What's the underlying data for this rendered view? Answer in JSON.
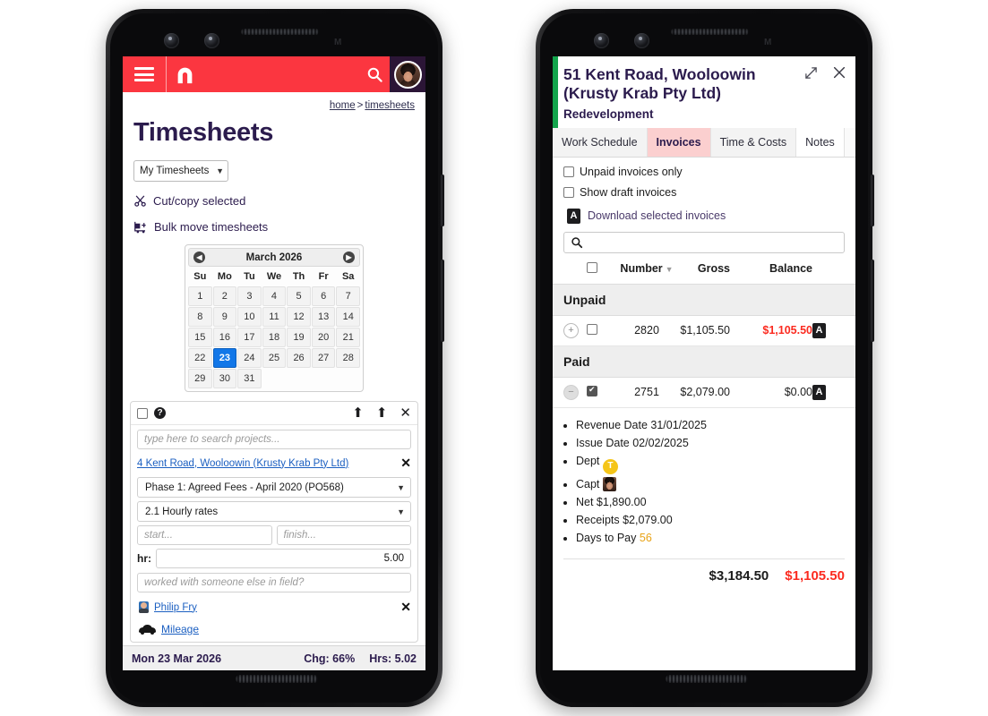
{
  "left_phone": {
    "app": {
      "topbar": {
        "menu_icon": "hamburger-menu-icon",
        "logo_icon": "arch-brand-logo",
        "search_icon": "search-icon",
        "avatar_icon": "user-avatar"
      },
      "breadcrumb": {
        "home": "home",
        "separator": ">",
        "current": "timesheets"
      },
      "page_title": "Timesheets",
      "filter_select": {
        "value": "My Timesheets",
        "chevron": "chevron-down-icon"
      },
      "actions": [
        {
          "icon": "scissors-icon",
          "label": "Cut/copy selected"
        },
        {
          "icon": "dolly-truck-icon",
          "label": "Bulk move timesheets"
        }
      ],
      "calendar": {
        "prev_icon": "prev-month-icon",
        "next_icon": "next-month-icon",
        "title": "March 2026",
        "dow": [
          "Su",
          "Mo",
          "Tu",
          "We",
          "Th",
          "Fr",
          "Sa"
        ],
        "lead_blanks": 0,
        "days": [
          1,
          2,
          3,
          4,
          5,
          6,
          7,
          8,
          9,
          10,
          11,
          12,
          13,
          14,
          15,
          16,
          17,
          18,
          19,
          20,
          21,
          22,
          23,
          24,
          25,
          26,
          27,
          28,
          29,
          30,
          31
        ],
        "selected": 23
      },
      "entry": {
        "header": {
          "checkbox": false,
          "help_icon": "help-icon",
          "icons": [
            "arrow-up-icon",
            "arrow-up-icon",
            "close-icon"
          ]
        },
        "project_search_placeholder": "type here to search projects...",
        "project_link": "4 Kent Road, Wooloowin (Krusty Krab Pty Ltd)",
        "project_remove_icon": "remove-project-icon",
        "phase_select": "Phase 1: Agreed Fees - April 2020 (PO568)",
        "rate_select": "2.1 Hourly rates",
        "start_placeholder": "start...",
        "finish_placeholder": "finish...",
        "hours_label": "hr:",
        "hours_value": "5.00",
        "note_placeholder": "worked with someone else in field?",
        "person": "Philip Fry",
        "person_remove_icon": "remove-person-icon",
        "mileage": "Mileage"
      },
      "status_bar": {
        "date": "Mon 23 Mar 2026",
        "chg": "Chg: 66%",
        "hrs": "Hrs: 5.02"
      }
    }
  },
  "right_phone": {
    "app": {
      "accent_color": "#13a44c",
      "header": {
        "title": "51 Kent Road, Wooloowin (Krusty Krab Pty Ltd)",
        "subtitle": "Redevelopment",
        "expand_icon": "expand-icon",
        "close_icon": "close-icon"
      },
      "tabs": [
        {
          "label": "Work Schedule",
          "active": false
        },
        {
          "label": "Invoices",
          "active": true
        },
        {
          "label": "Time & Costs",
          "active": false
        },
        {
          "label": "Notes",
          "active": false
        }
      ],
      "filters": [
        {
          "label": "Unpaid invoices only",
          "checked": false
        },
        {
          "label": "Show draft invoices",
          "checked": false
        }
      ],
      "download_action": {
        "icon": "pdf-icon",
        "label": "Download selected invoices"
      },
      "search_placeholder": "",
      "search_icon": "search-icon",
      "table": {
        "headers": {
          "select_all": "select-all-checkbox",
          "number": "Number",
          "sort_icon": "sort-descending-icon",
          "gross": "Gross",
          "balance": "Balance"
        },
        "groups": [
          {
            "name": "Unpaid",
            "rows": [
              {
                "expand": "plus",
                "checked": false,
                "number": "2820",
                "gross": "$1,105.50",
                "balance": "$1,105.50",
                "balance_color": "#fb2b20",
                "pdf_icon": "pdf-icon"
              }
            ]
          },
          {
            "name": "Paid",
            "rows": [
              {
                "expand": "minus",
                "checked": true,
                "number": "2751",
                "gross": "$2,079.00",
                "balance": "$0.00",
                "balance_color": "#1b1b1b",
                "pdf_icon": "pdf-icon"
              }
            ]
          }
        ]
      },
      "expanded_details": [
        {
          "text": "Revenue Date 31/01/2025"
        },
        {
          "text": "Issue Date 02/02/2025"
        },
        {
          "text": "Dept",
          "badge": "T",
          "badge_color": "#f5c518"
        },
        {
          "text": "Capt",
          "avatar": "captain-avatar"
        },
        {
          "text": "Net $1,890.00"
        },
        {
          "text": "Receipts $2,079.00"
        },
        {
          "text": "Days to Pay",
          "highlight": "56",
          "highlight_color": "#e8a317"
        }
      ],
      "totals": {
        "gross": "$3,184.50",
        "balance": "$1,105.50"
      }
    }
  }
}
